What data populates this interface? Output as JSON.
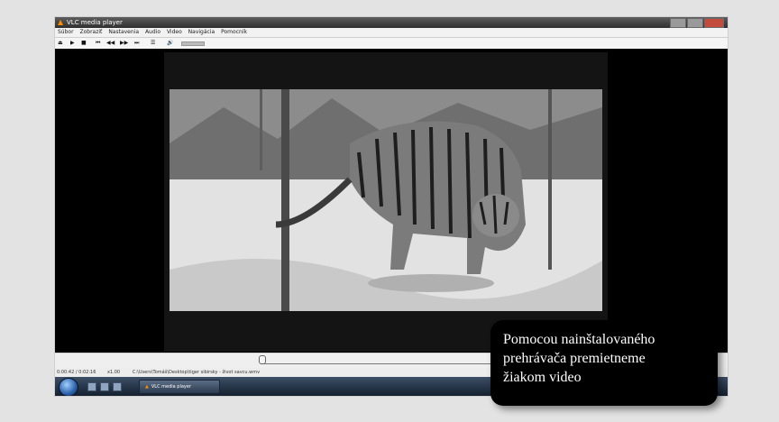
{
  "window": {
    "title": "VLC media player",
    "controls": [
      "minimize",
      "maximize",
      "close"
    ]
  },
  "menu": [
    "Súbor",
    "Zobraziť",
    "Nastavenia",
    "Audio",
    "Video",
    "Navigácia",
    "Pomocník"
  ],
  "toolbar": {
    "buttons": [
      {
        "name": "eject-icon",
        "glyph": "⏏"
      },
      {
        "name": "play-icon",
        "glyph": "▶"
      },
      {
        "name": "stop-icon",
        "glyph": "■"
      },
      {
        "name": "skip-back-icon",
        "glyph": "⏮"
      },
      {
        "name": "rewind-icon",
        "glyph": "◀◀"
      },
      {
        "name": "fast-forward-icon",
        "glyph": "▶▶"
      },
      {
        "name": "skip-forward-icon",
        "glyph": "⏭"
      },
      {
        "name": "playlist-icon",
        "glyph": "☰"
      },
      {
        "name": "volume-icon",
        "glyph": "🔊"
      }
    ]
  },
  "status": {
    "time": "0:00:42 / 0:02:16",
    "speed": "x1.00",
    "file_path": "C:\\Users\\Tomáš\\Desktop\\tiger sibirsky - život savcu.wmv"
  },
  "taskbar": {
    "task_label": "VLC media player"
  },
  "caption": {
    "lines": [
      "Pomocou nainštalovaného",
      "prehrávača  premietneme",
      "žiakom video"
    ]
  },
  "colors": {
    "vlc_orange": "#ff8c00",
    "video_bg": "#000000",
    "caption_bg": "#000000"
  }
}
